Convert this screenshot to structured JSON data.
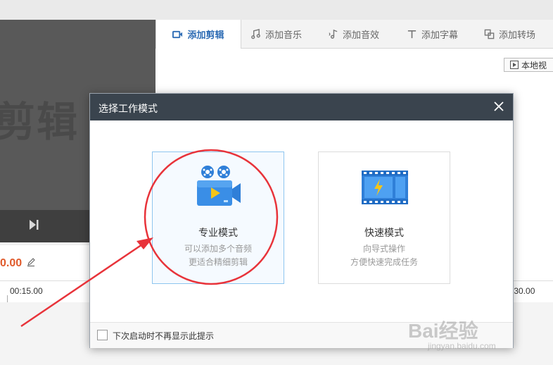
{
  "preview": {
    "watermark_text": "剪辑"
  },
  "tabs": [
    {
      "label": "添加剪辑",
      "icon": "video-camera-icon",
      "active": true
    },
    {
      "label": "添加音乐",
      "icon": "music-note-icon",
      "active": false
    },
    {
      "label": "添加音效",
      "icon": "sound-effect-icon",
      "active": false
    },
    {
      "label": "添加字幕",
      "icon": "text-t-icon",
      "active": false
    },
    {
      "label": "添加转场",
      "icon": "transition-icon",
      "active": false
    }
  ],
  "local_video_button": "本地视",
  "timeline": {
    "current_time": "0.00",
    "ruler_labels": [
      "00:15.00",
      ":30.00"
    ]
  },
  "dialog": {
    "title": "选择工作模式",
    "pro_mode": {
      "title": "专业模式",
      "desc_line1": "可以添加多个音频",
      "desc_line2": "更适合精细剪辑"
    },
    "quick_mode": {
      "title": "快速模式",
      "desc_line1": "向导式操作",
      "desc_line2": "方便快速完成任务"
    },
    "dont_show_again": "下次启动时不再显示此提示"
  },
  "watermark": {
    "brand": "Bai经验",
    "url": "jingyan.baidu.com"
  },
  "colors": {
    "accent_blue": "#2f6db5",
    "dialog_header": "#3a444e",
    "annotation_red": "#e8333a",
    "time_orange": "#e05a2b"
  }
}
